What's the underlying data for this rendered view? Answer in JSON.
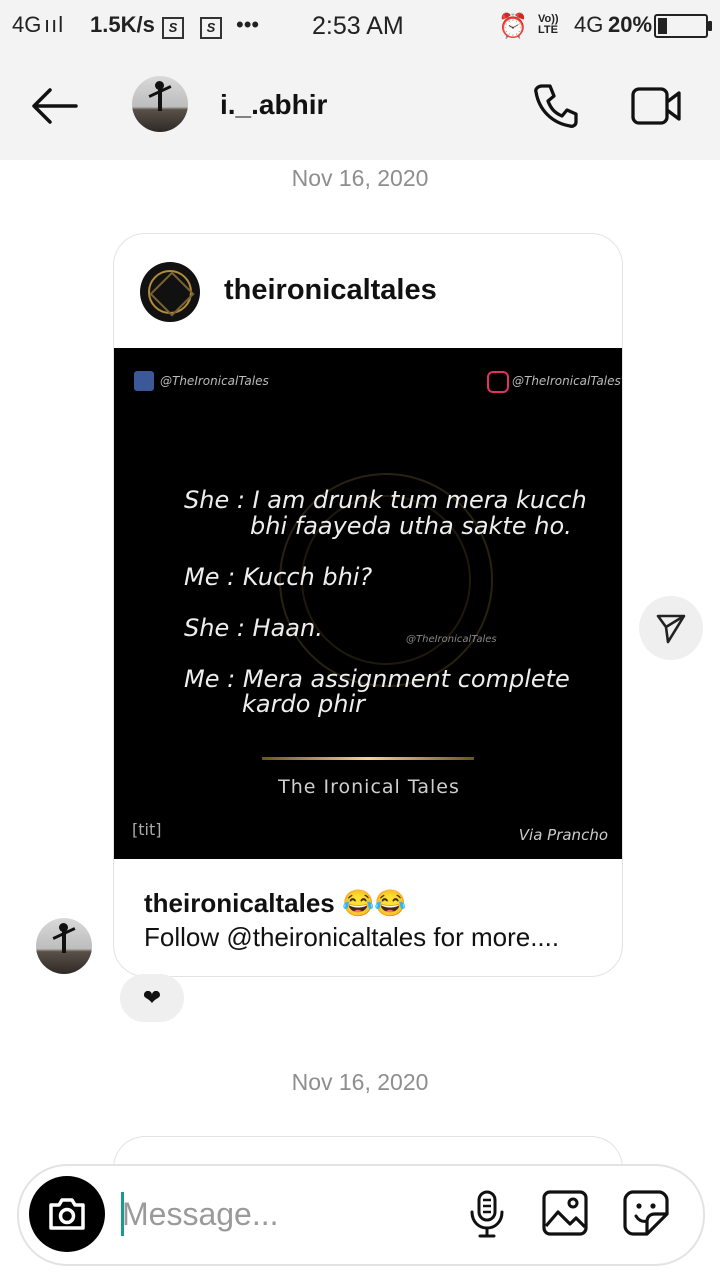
{
  "status_bar": {
    "network": "4G",
    "speed": "1.5K/s",
    "time": "2:53 AM",
    "volte": "Vo)) LTE",
    "network2": "4G",
    "battery": "20%",
    "battery_level": 0.2
  },
  "header": {
    "username": "i._.abhir"
  },
  "messages": [
    {
      "date": "Nov 16, 2020",
      "shared_post": {
        "account": "theironicaltales",
        "image": {
          "fb_handle": "@TheIronicalTales",
          "ig_handle": "@TheIronicalTales",
          "lines": [
            "She : I am drunk tum mera kucch",
            "bhi faayeda utha sakte ho.",
            "Me : Kucch bhi?",
            "She : Haan.",
            "Me : Mera assignment complete",
            "kardo phir"
          ],
          "watermark": "@TheIronicalTales",
          "brand": "The Ironical Tales",
          "tag": "[tit]",
          "credit": "Via Prancho"
        },
        "caption_account": "theironicaltales 😂😂",
        "caption_text": "Follow @theironicaltales for more...."
      },
      "reaction": "❤"
    },
    {
      "date": "Nov 16, 2020"
    }
  ],
  "composer": {
    "placeholder": "Message..."
  }
}
